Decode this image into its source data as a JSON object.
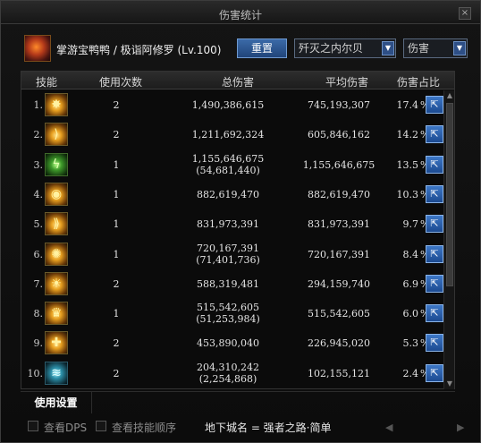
{
  "window": {
    "title": "伤害统计",
    "close_glyph": "×"
  },
  "header": {
    "char_name": "掌游宝鸭鸭 / 极诣阿修罗 (Lv.100)",
    "reset_label": "重置",
    "dungeon_select": "歼灭之内尔贝",
    "metric_select": "伤害"
  },
  "table": {
    "columns": [
      "技能",
      "使用次数",
      "总伤害",
      "平均伤害",
      "伤害占比"
    ],
    "rows": [
      {
        "num": "1.",
        "icon": "fire-slash-icon",
        "uses": "2",
        "total": "1,490,386,615",
        "sub": "",
        "avg": "745,193,307",
        "pct": "17.4",
        "pct_sign": "%"
      },
      {
        "num": "2.",
        "icon": "crescent-wave-icon",
        "uses": "2",
        "total": "1,211,692,324",
        "sub": "",
        "avg": "605,846,162",
        "pct": "14.2",
        "pct_sign": "%"
      },
      {
        "num": "3.",
        "icon": "lightning-icon",
        "uses": "1",
        "total": "1,155,646,675",
        "sub": "(54,681,440)",
        "avg": "1,155,646,675",
        "pct": "13.5",
        "pct_sign": "%"
      },
      {
        "num": "4.",
        "icon": "eye-vortex-icon",
        "uses": "1",
        "total": "882,619,470",
        "sub": "",
        "avg": "882,619,470",
        "pct": "10.3",
        "pct_sign": "%"
      },
      {
        "num": "5.",
        "icon": "dash-strike-icon",
        "uses": "1",
        "total": "831,973,391",
        "sub": "",
        "avg": "831,973,391",
        "pct": "9.7",
        "pct_sign": "%"
      },
      {
        "num": "6.",
        "icon": "spin-slash-icon",
        "uses": "1",
        "total": "720,167,391",
        "sub": "(71,401,736)",
        "avg": "720,167,391",
        "pct": "8.4",
        "pct_sign": "%"
      },
      {
        "num": "7.",
        "icon": "demon-face-icon",
        "uses": "2",
        "total": "588,319,481",
        "sub": "",
        "avg": "294,159,740",
        "pct": "6.9",
        "pct_sign": "%"
      },
      {
        "num": "8.",
        "icon": "crown-burst-icon",
        "uses": "1",
        "total": "515,542,605",
        "sub": "(51,253,984)",
        "avg": "515,542,605",
        "pct": "6.0",
        "pct_sign": "%"
      },
      {
        "num": "9.",
        "icon": "cross-flash-icon",
        "uses": "2",
        "total": "453,890,040",
        "sub": "",
        "avg": "226,945,020",
        "pct": "5.3",
        "pct_sign": "%"
      },
      {
        "num": "10.",
        "icon": "ice-wave-icon",
        "uses": "2",
        "total": "204,310,242",
        "sub": "(2,254,868)",
        "avg": "102,155,121",
        "pct": "2.4",
        "pct_sign": "%"
      }
    ]
  },
  "tabs": {
    "usage_settings": "使用设置"
  },
  "footer": {
    "view_dps": "查看DPS",
    "view_skill_order": "查看技能顺序",
    "dungeon_name": "地下城名 = 强者之路·简单"
  },
  "colors": {
    "accent_blue": "#2e5fa8",
    "panel_bg": "#0c0c0c",
    "text": "#e4e4e4"
  }
}
